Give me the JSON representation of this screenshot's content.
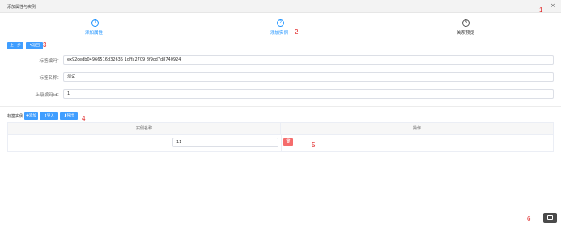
{
  "window": {
    "title": "添加属性与实例",
    "close_glyph": "×"
  },
  "annotations": {
    "a1": "1",
    "a2": "2",
    "a3": "3",
    "a4": "4",
    "a5": "5",
    "a6": "6"
  },
  "steps": [
    {
      "num": "1",
      "label": "添加属性",
      "state": "done"
    },
    {
      "num": "2",
      "label": "添加实例",
      "state": "active"
    },
    {
      "num": "3",
      "label": "关系预览",
      "state": "pending"
    }
  ],
  "toolbar": {
    "btn1": "上一步",
    "btn2": "↰返回"
  },
  "form": {
    "code_label": "标签编码：",
    "code_value": "ex92cedb04966516d32635 1dffa2709 8f9cd7d8740924",
    "name_label": "标签名称：",
    "name_value": "测试",
    "parent_label": "上级编码id：",
    "parent_value": "1"
  },
  "instances": {
    "section_label": "标签实例",
    "add_btn": "✚添加",
    "import_btn": "⬆导入",
    "export_btn": "⬇导出",
    "col_name": "实例名称",
    "col_action": "操作",
    "rows": [
      {
        "name": "11",
        "delete_glyph": "🗑"
      }
    ]
  },
  "colors": {
    "primary": "#409eff",
    "danger": "#f56c6c",
    "step_line_active": "#1890ff",
    "annotation": "#e02020"
  },
  "icons": {
    "fab": "screen-icon"
  }
}
